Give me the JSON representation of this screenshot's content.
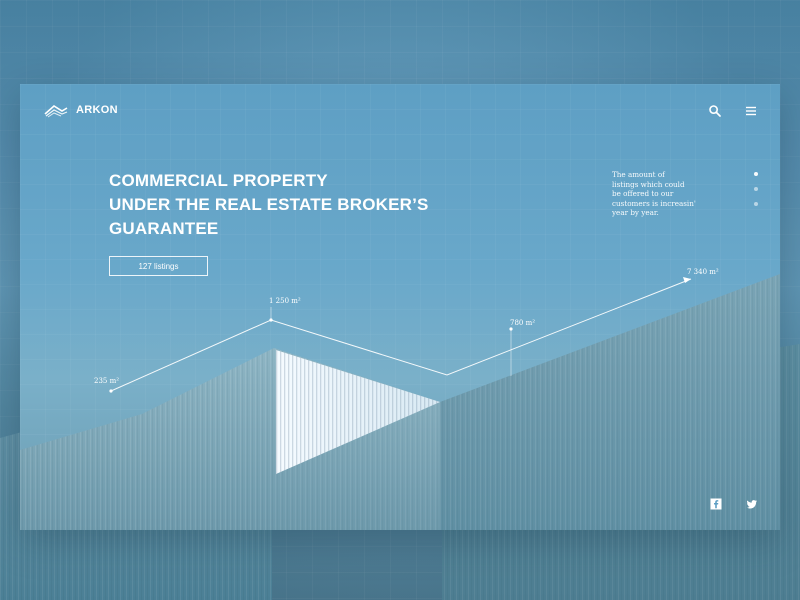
{
  "brand": {
    "name": "ARKON"
  },
  "hero": {
    "headline_lines": [
      "COMMERCIAL PROPERTY",
      "UNDER THE REAL ESTATE BROKER’S",
      "GUARANTEE"
    ],
    "cta_label": "127 listings"
  },
  "side_note": {
    "lines": [
      "The amount of",
      "listings which could",
      "be offered to our",
      "customers is increasin'",
      "year by year."
    ]
  },
  "metrics": {
    "labels": [
      "235 m²",
      "1 250 m²",
      "780 m²",
      "7 340 m²"
    ]
  },
  "icons": {
    "logo": "logo-mark-icon",
    "search": "search-icon",
    "menu": "menu-icon",
    "facebook": "facebook-icon",
    "twitter": "twitter-icon"
  },
  "pager": {
    "dots": [
      {
        "active": true
      },
      {
        "active": false
      },
      {
        "active": false
      }
    ]
  },
  "colors": {
    "primary_blue": "#5e9fc4",
    "light_blue": "#7ab0c9",
    "deep_blue": "#4f8099",
    "white": "#ffffff"
  }
}
